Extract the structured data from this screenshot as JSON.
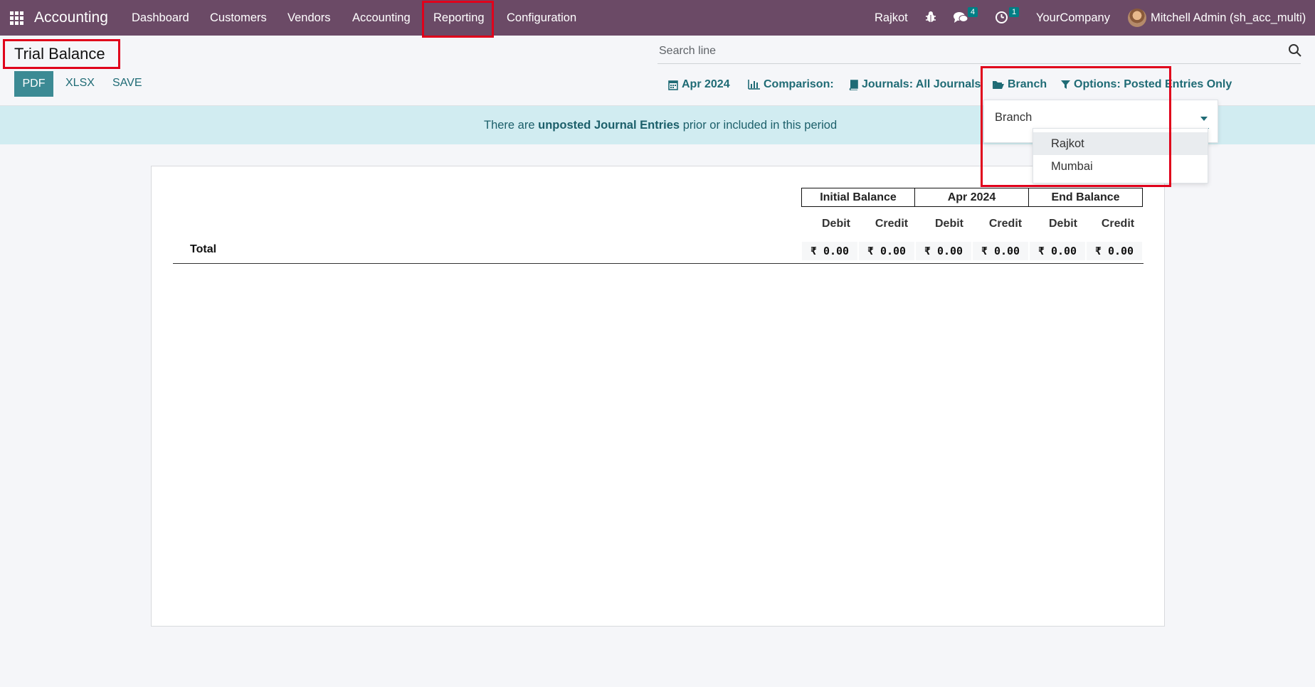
{
  "navbar": {
    "brand": "Accounting",
    "menu": [
      "Dashboard",
      "Customers",
      "Vendors",
      "Accounting",
      "Reporting",
      "Configuration"
    ],
    "branch": "Rajkot",
    "messages_count": "4",
    "activities_count": "1",
    "company": "YourCompany",
    "user": "Mitchell Admin (sh_acc_multi)"
  },
  "page": {
    "title": "Trial Balance",
    "buttons": {
      "pdf": "PDF",
      "xlsx": "XLSX",
      "save": "SAVE"
    },
    "search_placeholder": "Search line"
  },
  "filters": {
    "date": "Apr 2024",
    "comparison": "Comparison:",
    "journals": "Journals: All Journals",
    "branch": "Branch",
    "options": "Options: Posted Entries Only"
  },
  "alert": {
    "prefix": "There are",
    "link": "unposted Journal Entries",
    "suffix": "prior or included in this period"
  },
  "branch_dropdown": {
    "label": "Branch",
    "options": [
      "Rajkot",
      "Mumbai"
    ],
    "highlighted": "Rajkot"
  },
  "report": {
    "groups": [
      "Initial Balance",
      "Apr 2024",
      "End Balance"
    ],
    "subheaders": [
      "Debit",
      "Credit",
      "Debit",
      "Credit",
      "Debit",
      "Credit"
    ],
    "total_label": "Total",
    "totals": [
      "₹ 0.00",
      "₹ 0.00",
      "₹ 0.00",
      "₹ 0.00",
      "₹ 0.00",
      "₹ 0.00"
    ]
  },
  "colors": {
    "navbar": "#6b4a66",
    "accent": "#3c8a94",
    "alert_bg": "#d1ecf1",
    "highlight_box": "#e0001b"
  }
}
